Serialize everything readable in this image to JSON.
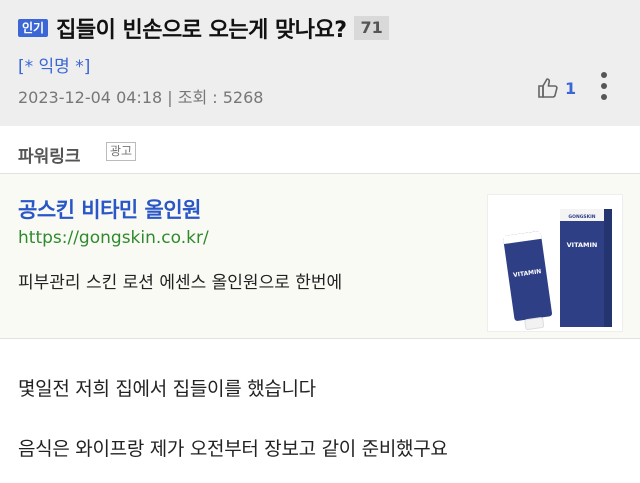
{
  "post": {
    "hot_badge": "인기",
    "title": "집들이 빈손으로 오는게 맞나요?",
    "comment_count": "71",
    "author": "[* 익명 *]",
    "meta": "2023-12-04 04:18 | 조회 : 5268",
    "like_count": "1"
  },
  "powerlink": {
    "title": "파워링크",
    "ad_tag": "광고",
    "ad": {
      "headline": "공스킨 비타민 올인원",
      "url": "https://gongskin.co.kr/",
      "description": "피부관리 스킨 로션 에센스 올인원으로 한번에",
      "image_text_brand": "GONGSKIN",
      "image_text_product": "VITAMIN"
    }
  },
  "content": {
    "lines": [
      "몇일전 저희 집에서 집들이를 했습니다",
      "음식은 와이프랑 제가 오전부터 장보고 같이 준비했구요"
    ]
  },
  "icons": {
    "like": "thumbs-up-icon",
    "more": "more-vertical-icon"
  },
  "colors": {
    "accent_blue": "#3b66d6",
    "ad_link_blue": "#2a57c7",
    "url_green": "#2f8a2f",
    "header_bg": "#eeeeee",
    "ad_bg": "#fafaf5"
  }
}
